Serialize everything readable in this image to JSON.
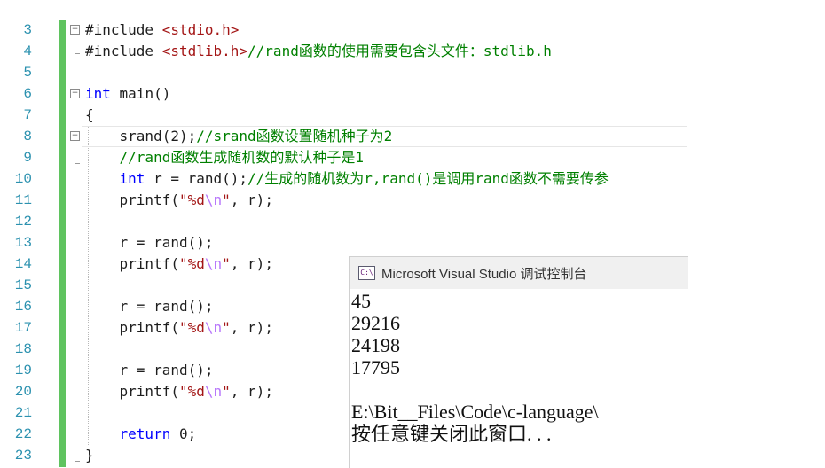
{
  "editor": {
    "line_numbers": [
      "3",
      "4",
      "5",
      "6",
      "7",
      "8",
      "9",
      "10",
      "11",
      "12",
      "13",
      "14",
      "15",
      "16",
      "17",
      "18",
      "19",
      "20",
      "21",
      "22",
      "23"
    ],
    "lines": [
      {
        "num": "3",
        "tokens": [
          {
            "t": "#include ",
            "c": "pp"
          },
          {
            "t": "<stdio.h>",
            "c": "str"
          }
        ]
      },
      {
        "num": "4",
        "tokens": [
          {
            "t": "#include ",
            "c": "pp"
          },
          {
            "t": "<stdlib.h>",
            "c": "str"
          },
          {
            "t": "//rand函数的使用需要包含头文件：stdlib.h",
            "c": "cm"
          }
        ]
      },
      {
        "num": "5",
        "tokens": []
      },
      {
        "num": "6",
        "tokens": [
          {
            "t": "int",
            "c": "kw"
          },
          {
            "t": " main()",
            "c": "pl"
          }
        ]
      },
      {
        "num": "7",
        "tokens": [
          {
            "t": "{",
            "c": "pl"
          }
        ]
      },
      {
        "num": "8",
        "tokens": [
          {
            "t": "    srand(2);",
            "c": "pl"
          },
          {
            "t": "//srand函数设置随机种子为2",
            "c": "cm"
          }
        ]
      },
      {
        "num": "9",
        "tokens": [
          {
            "t": "    ",
            "c": "pl"
          },
          {
            "t": "//rand函数生成随机数的默认种子是1",
            "c": "cm"
          }
        ]
      },
      {
        "num": "10",
        "tokens": [
          {
            "t": "    ",
            "c": "pl"
          },
          {
            "t": "int",
            "c": "kw"
          },
          {
            "t": " r = rand();",
            "c": "pl"
          },
          {
            "t": "//生成的随机数为r,rand()是调用rand函数不需要传参",
            "c": "cm"
          }
        ]
      },
      {
        "num": "11",
        "tokens": [
          {
            "t": "    printf(",
            "c": "pl"
          },
          {
            "t": "\"%d",
            "c": "str"
          },
          {
            "t": "\\n",
            "c": "esc"
          },
          {
            "t": "\"",
            "c": "str"
          },
          {
            "t": ", r);",
            "c": "pl"
          }
        ]
      },
      {
        "num": "12",
        "tokens": []
      },
      {
        "num": "13",
        "tokens": [
          {
            "t": "    r = rand();",
            "c": "pl"
          }
        ]
      },
      {
        "num": "14",
        "tokens": [
          {
            "t": "    printf(",
            "c": "pl"
          },
          {
            "t": "\"%d",
            "c": "str"
          },
          {
            "t": "\\n",
            "c": "esc"
          },
          {
            "t": "\"",
            "c": "str"
          },
          {
            "t": ", r);",
            "c": "pl"
          }
        ]
      },
      {
        "num": "15",
        "tokens": []
      },
      {
        "num": "16",
        "tokens": [
          {
            "t": "    r = rand();",
            "c": "pl"
          }
        ]
      },
      {
        "num": "17",
        "tokens": [
          {
            "t": "    printf(",
            "c": "pl"
          },
          {
            "t": "\"%d",
            "c": "str"
          },
          {
            "t": "\\n",
            "c": "esc"
          },
          {
            "t": "\"",
            "c": "str"
          },
          {
            "t": ", r);",
            "c": "pl"
          }
        ]
      },
      {
        "num": "18",
        "tokens": []
      },
      {
        "num": "19",
        "tokens": [
          {
            "t": "    r = rand();",
            "c": "pl"
          }
        ]
      },
      {
        "num": "20",
        "tokens": [
          {
            "t": "    printf(",
            "c": "pl"
          },
          {
            "t": "\"%d",
            "c": "str"
          },
          {
            "t": "\\n",
            "c": "esc"
          },
          {
            "t": "\"",
            "c": "str"
          },
          {
            "t": ", r);",
            "c": "pl"
          }
        ]
      },
      {
        "num": "21",
        "tokens": []
      },
      {
        "num": "22",
        "tokens": [
          {
            "t": "    ",
            "c": "pl"
          },
          {
            "t": "return",
            "c": "kw"
          },
          {
            "t": " 0;",
            "c": "pl"
          }
        ]
      },
      {
        "num": "23",
        "tokens": [
          {
            "t": "}",
            "c": "pl"
          }
        ]
      }
    ],
    "colors": {
      "line_number": "#2b91af",
      "keyword": "#0000ff",
      "string": "#a31515",
      "escape": "#b776fb",
      "comment": "#008000",
      "change_bar": "#5fc35f"
    }
  },
  "console": {
    "title": "Microsoft Visual Studio 调试控制台",
    "icon": "console-app-icon",
    "output": [
      "45",
      "29216",
      "24198",
      "17795",
      "",
      "E:\\Bit__Files\\Code\\c-language\\",
      "按任意键关闭此窗口. . ."
    ]
  }
}
